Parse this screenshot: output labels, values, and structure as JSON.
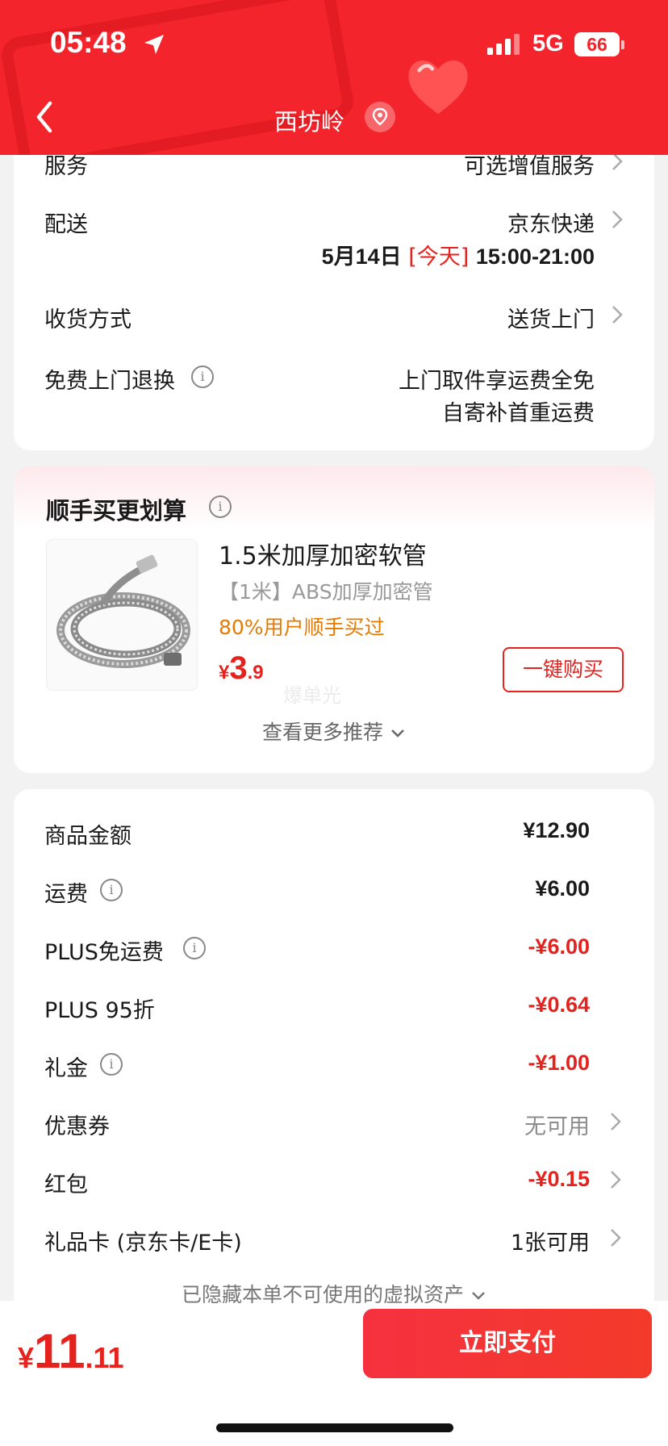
{
  "status_bar": {
    "time": "05:48",
    "network": "5G",
    "battery": "66"
  },
  "nav": {
    "title": "西坊岭"
  },
  "delivery": {
    "service_label": "服务",
    "service_value": "可选增值服务",
    "shipping_label": "配送",
    "shipping_value": "京东快递",
    "shipping_date": "5月14日",
    "shipping_today": "[今天]",
    "shipping_window": "15:00-21:00",
    "receive_label": "收货方式",
    "receive_value": "送货上门",
    "return_label": "免费上门退换",
    "return_line1": "上门取件享运费全免",
    "return_line2": "自寄补首重运费"
  },
  "recommend": {
    "title": "顺手买更划算",
    "product_name": "1.5米加厚加密软管",
    "product_spec": "【1米】ABS加厚加密管",
    "product_promo": "80%用户顺手买过",
    "price_currency": "¥",
    "price_int": "3",
    "price_dec": ".9",
    "buy_label": "一键购买",
    "watermark": "爆单光",
    "more_label": "查看更多推荐"
  },
  "summary": {
    "rows": [
      {
        "label": "商品金额",
        "value": "¥12.90"
      },
      {
        "label": "运费",
        "value": "¥6.00"
      },
      {
        "label": "PLUS免运费",
        "value": "-¥6.00"
      },
      {
        "label": "PLUS 95折",
        "value": "-¥0.64"
      },
      {
        "label": "礼金",
        "value": "-¥1.00"
      },
      {
        "label": "优惠券",
        "value": "无可用"
      },
      {
        "label": "红包",
        "value": "-¥0.15"
      },
      {
        "label": "礼品卡 (京东卡/E卡)",
        "value": "1张可用"
      }
    ],
    "hidden_assets": "已隐藏本单不可使用的虚拟资产"
  },
  "bottom": {
    "total_currency": "¥",
    "total_int": "11",
    "total_dec": ".11",
    "pay_label": "立即支付"
  },
  "colors": {
    "brand_red": "#f3242b",
    "price_red": "#e4231f",
    "promo_orange": "#e67a00"
  }
}
